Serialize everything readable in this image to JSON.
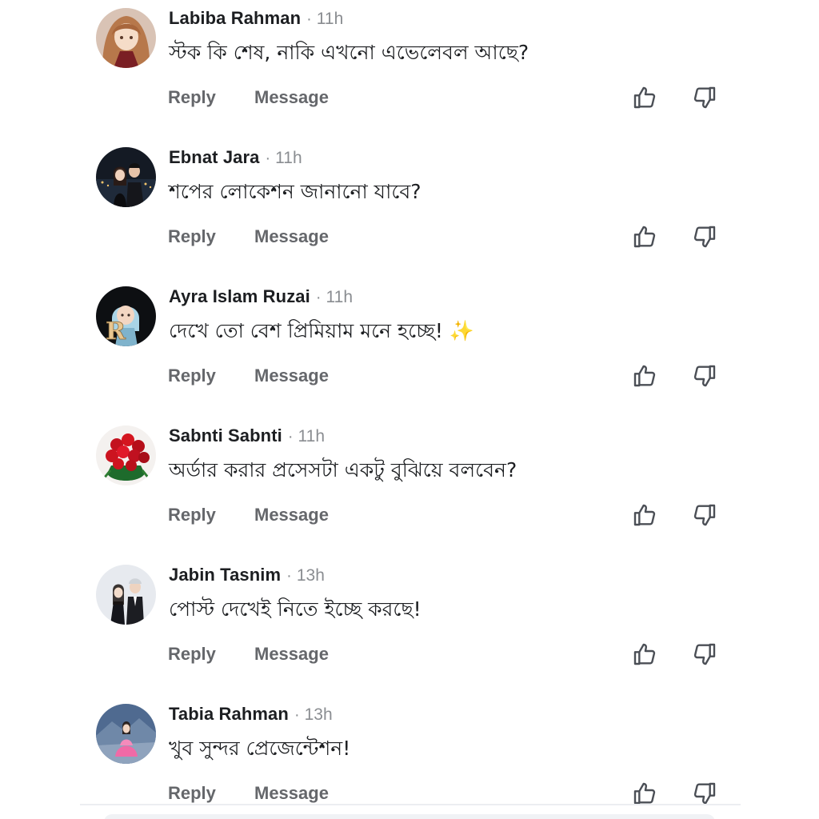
{
  "comments": [
    {
      "author": "Labiba Rahman",
      "separator": "·",
      "time": "11h",
      "text": "স্টক কি শেষ, নাকি এখনো এভেলেবল আছে?",
      "reply_label": "Reply",
      "message_label": "Message",
      "avatar": "anime-girl-avatar"
    },
    {
      "author": "Ebnat Jara",
      "separator": "·",
      "time": "11h",
      "text": "শপের লোকেশন জানানো যাবে?",
      "reply_label": "Reply",
      "message_label": "Message",
      "avatar": "couple-night-city-avatar"
    },
    {
      "author": "Ayra Islam Ruzai",
      "separator": "·",
      "time": "11h",
      "text": "দেখে তো বেশ প্রিমিয়াম মনে হচ্ছে! ✨",
      "reply_label": "Reply",
      "message_label": "Message",
      "avatar": "hijab-girl-letter-r-avatar",
      "avatar_letter": "R"
    },
    {
      "author": "Sabnti Sabnti",
      "separator": "·",
      "time": "11h",
      "text": "অর্ডার করার প্রসেসটা একটু বুঝিয়ে বলবেন?",
      "reply_label": "Reply",
      "message_label": "Message",
      "avatar": "red-roses-avatar"
    },
    {
      "author": "Jabin Tasnim",
      "separator": "·",
      "time": "13h",
      "text": "পোস্ট দেখেই নিতে ইচ্ছে করছে!",
      "reply_label": "Reply",
      "message_label": "Message",
      "avatar": "couple-formal-avatar"
    },
    {
      "author": "Tabia Rahman",
      "separator": "·",
      "time": "13h",
      "text": "খুব সুন্দর প্রেজেন্টেশন!",
      "reply_label": "Reply",
      "message_label": "Message",
      "avatar": "girl-pink-dress-avatar"
    }
  ],
  "icons": {
    "like": "thumbs-up-icon",
    "dislike": "thumbs-down-icon"
  },
  "colors": {
    "author": "#1c1e21",
    "meta": "#8a8d91",
    "action": "#65676b",
    "icon": "#4b4f56"
  }
}
